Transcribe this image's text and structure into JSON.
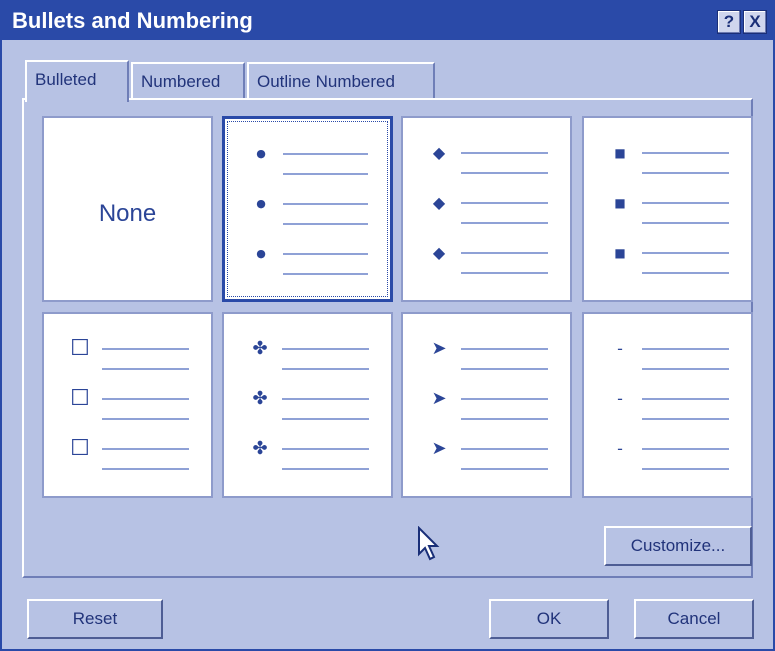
{
  "window": {
    "title": "Bullets and Numbering",
    "help_label": "?",
    "close_label": "X"
  },
  "tabs": [
    {
      "label": "Bulleted",
      "active": true
    },
    {
      "label": "Numbered",
      "active": false
    },
    {
      "label": "Outline Numbered",
      "active": false
    }
  ],
  "bullet_gallery": [
    {
      "style": "None",
      "glyph": "",
      "selected": false
    },
    {
      "style": "round",
      "glyph": "●",
      "selected": true
    },
    {
      "style": "diamond",
      "glyph": "◆",
      "selected": false
    },
    {
      "style": "square",
      "glyph": "■",
      "selected": false
    },
    {
      "style": "hollow-square",
      "glyph": "☐",
      "selected": false
    },
    {
      "style": "four-diamond",
      "glyph": "✤",
      "selected": false
    },
    {
      "style": "arrowhead",
      "glyph": "➤",
      "selected": false
    },
    {
      "style": "dash",
      "glyph": "-",
      "selected": false
    }
  ],
  "buttons": {
    "customize": "Customize...",
    "reset": "Reset",
    "ok": "OK",
    "cancel": "Cancel"
  },
  "colors": {
    "titlebar": "#2a4aa8",
    "dialog_bg": "#b7c2e4",
    "accent": "#2b4597",
    "line": "#8fa1d6"
  }
}
